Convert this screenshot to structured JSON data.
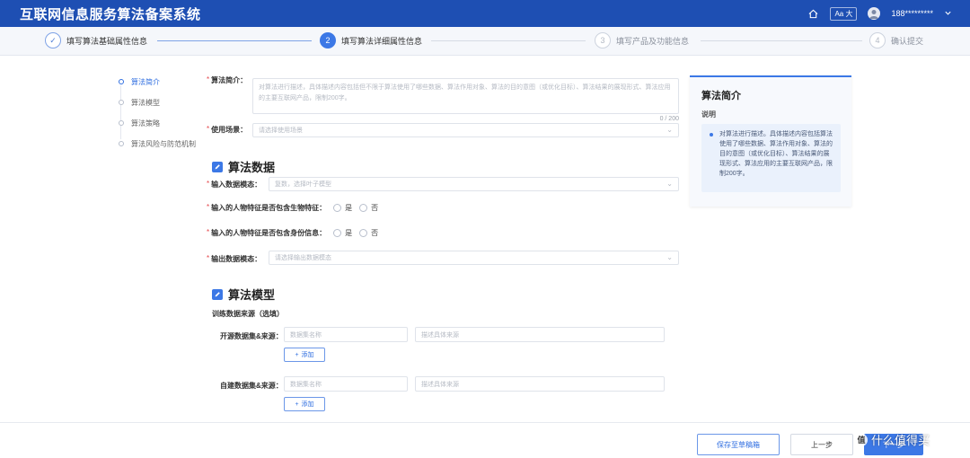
{
  "header": {
    "title": "互联网信息服务算法备案系统",
    "font_button": "Aa 大",
    "user_name": "188*********"
  },
  "steps": [
    {
      "index": "✓",
      "label": "填写算法基础属性信息",
      "state": "done"
    },
    {
      "index": "2",
      "label": "填写算法详细属性信息",
      "state": "active"
    },
    {
      "index": "3",
      "label": "填写产品及功能信息",
      "state": "todo"
    },
    {
      "index": "4",
      "label": "确认提交",
      "state": "todo"
    }
  ],
  "leftnav": {
    "items": [
      {
        "label": "算法简介",
        "active": true
      },
      {
        "label": "算法模型",
        "active": false
      },
      {
        "label": "算法策略",
        "active": false
      },
      {
        "label": "算法风险与防范机制",
        "active": false
      }
    ]
  },
  "form": {
    "intro": {
      "label": "算法简介：",
      "placeholder": "对算法进行描述，具体描述内容包括但不限于算法使用了哪些数据、算法作用对象、算法的目的意图（或优化目标）、算法结果的展现形式、算法应用的主要互联网产品，限制200字。",
      "counter": "0 / 200"
    },
    "scenario": {
      "label": "使用场景：",
      "placeholder": "请选择使用场景"
    },
    "section_data": {
      "title": "算法数据",
      "input_modality": {
        "label": "输入数据模态：",
        "placeholder": "复数，选择叶子模型"
      },
      "biometric": {
        "label": "输入的人物特征是否包含生物特征：",
        "yes": "是",
        "no": "否"
      },
      "identity": {
        "label": "输入的人物特征是否包含身份信息：",
        "yes": "是",
        "no": "否"
      },
      "output_modality": {
        "label": "输出数据模态：",
        "placeholder": "请选择输出数据模态"
      }
    },
    "section_model": {
      "title": "算法模型",
      "training_source": "训练数据来源（选填）",
      "open_dataset": {
        "label": "开源数据集&来源：",
        "name_placeholder": "数据集名称",
        "source_placeholder": "描述具体来源",
        "add": "添加"
      },
      "own_dataset": {
        "label": "自建数据集&来源：",
        "name_placeholder": "数据集名称",
        "source_placeholder": "描述具体来源",
        "add": "添加"
      }
    }
  },
  "side_panel": {
    "title": "算法简介",
    "subtitle": "说明",
    "text": "对算法进行描述。具体描述内容包括算法使用了哪些数据、算法作用对象、算法的目的意图（或优化目标）、算法结果的展现形式、算法应用的主要互联网产品，限制200字。"
  },
  "footer": {
    "save_draft": "保存至草稿箱",
    "prev": "上一步",
    "next": "下一步"
  },
  "watermark": "值 什么值得买",
  "colors": {
    "brand": "#1e4fb3",
    "accent": "#3c78e6",
    "required": "#e5484d"
  }
}
